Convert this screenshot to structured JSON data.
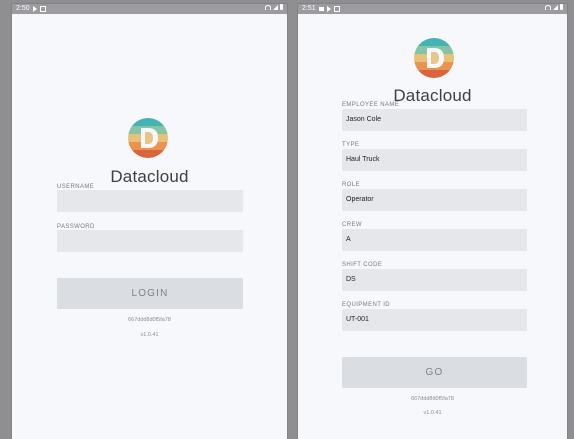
{
  "colors": {
    "screen_bg": "#f7f8fb",
    "statusbar_bg": "#9c9ca0",
    "input_bg": "#e6e7ea",
    "button_bg": "#dadde2",
    "button_text": "#7e838b",
    "logo_stripes": [
      "#44b3b5",
      "#86c4a8",
      "#e7c07a",
      "#e9934f",
      "#d8653c"
    ]
  },
  "left": {
    "status_time": "2:50",
    "brand": "Datacloud",
    "username_label": "USERNAME",
    "username_value": "",
    "password_label": "PASSWORD",
    "password_value": "",
    "login_label": "LOGIN",
    "device_id": "667ddd8d0f5fa78",
    "version": "v1.0.41"
  },
  "right": {
    "status_time": "2:51",
    "brand": "Datacloud",
    "fields": [
      {
        "label": "EMPLOYEE NAME",
        "value": "Jason Cole"
      },
      {
        "label": "TYPE",
        "value": "Haul Truck"
      },
      {
        "label": "ROLE",
        "value": "Operator"
      },
      {
        "label": "CREW",
        "value": "A"
      },
      {
        "label": "SHIFT CODE",
        "value": "DS"
      },
      {
        "label": "EQUIPMENT ID",
        "value": "UT-001"
      }
    ],
    "go_label": "GO",
    "device_id": "667ddd8d0f5fa78",
    "version": "v1.0.41"
  }
}
